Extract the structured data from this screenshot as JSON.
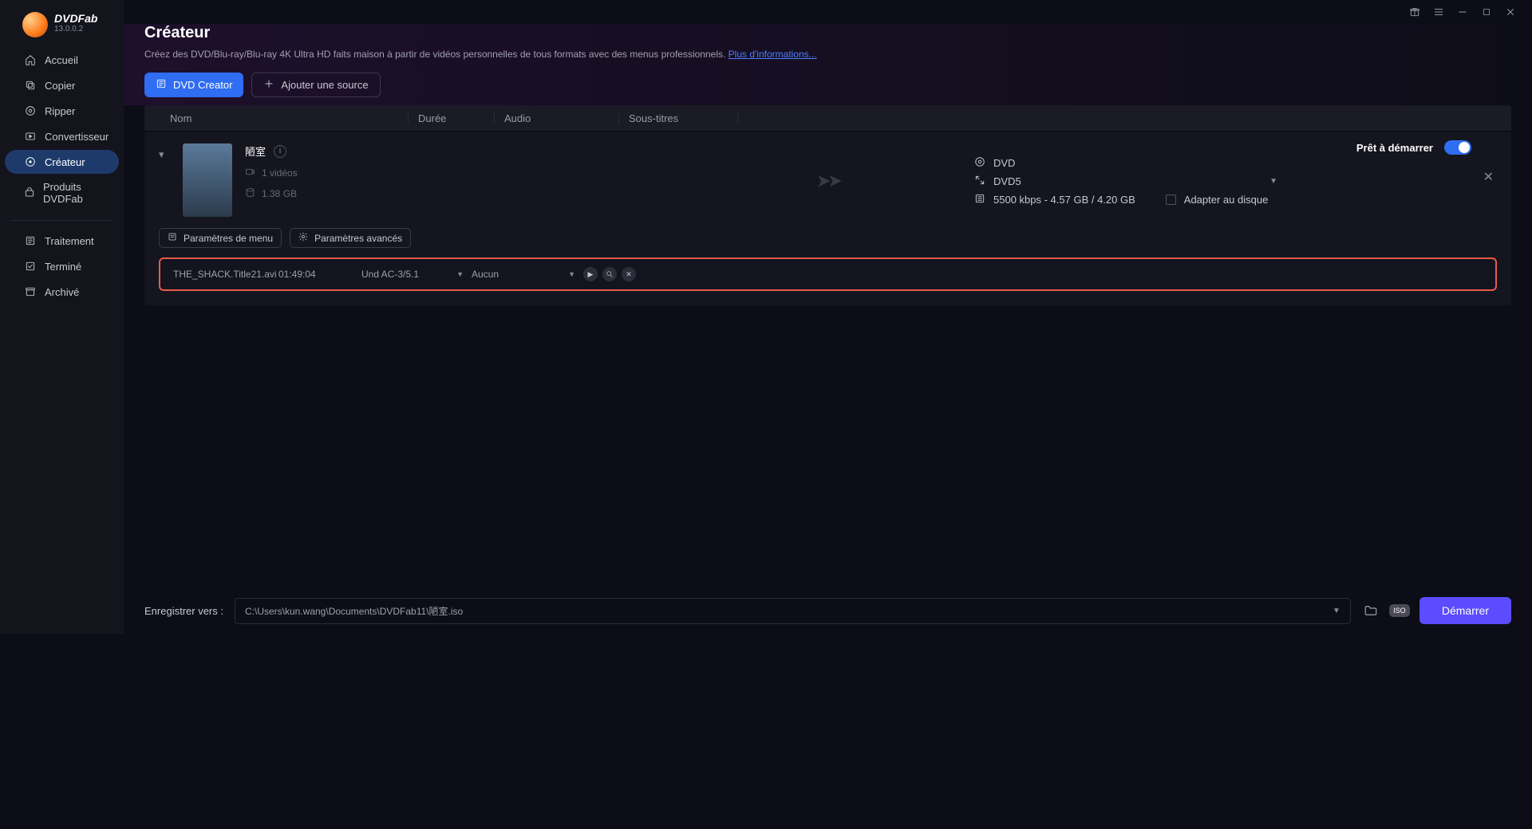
{
  "brand": {
    "name": "DVDFab",
    "version": "13.0.0.2"
  },
  "sidebar": {
    "items": [
      {
        "label": "Accueil",
        "icon": "home-icon"
      },
      {
        "label": "Copier",
        "icon": "copy-icon"
      },
      {
        "label": "Ripper",
        "icon": "ripper-icon"
      },
      {
        "label": "Convertisseur",
        "icon": "converter-icon"
      },
      {
        "label": "Créateur",
        "icon": "creator-icon"
      },
      {
        "label": "Produits DVDFab",
        "icon": "products-icon"
      }
    ],
    "items2": [
      {
        "label": "Traitement",
        "icon": "process-icon"
      },
      {
        "label": "Terminé",
        "icon": "done-icon"
      },
      {
        "label": "Archivé",
        "icon": "archive-icon"
      }
    ]
  },
  "header": {
    "title": "Créateur",
    "desc": "Créez des DVD/Blu-ray/Blu-ray 4K Ultra HD faits maison à partir de vidéos personnelles de tous formats avec des menus professionnels. ",
    "more": "Plus d'informations...",
    "btn_creator": "DVD Creator",
    "btn_add": "Ajouter une source"
  },
  "table": {
    "name": "Nom",
    "duration": "Durée",
    "audio": "Audio",
    "subtitle": "Sous-titres"
  },
  "task": {
    "title": "陋室",
    "videos": "1 vidéos",
    "size": "1.38 GB",
    "ready": "Prêt à démarrer",
    "menu_btn": "Paramètres de menu",
    "adv_btn": "Paramètres avancés",
    "output": {
      "disc_type": "DVD",
      "disc_size": "DVD5",
      "bitrate": "5500 kbps - 4.57 GB / 4.20 GB",
      "fit_label": "Adapter au disque"
    }
  },
  "title_row": {
    "filename": "THE_SHACK.Title21.avi",
    "duration": "01:49:04",
    "audio": "Und  AC-3/5.1",
    "subtitle": "Aucun"
  },
  "footer": {
    "save_to": "Enregistrer vers :",
    "path": "C:\\Users\\kun.wang\\Documents\\DVDFab11\\陋室.iso",
    "start": "Démarrer"
  }
}
